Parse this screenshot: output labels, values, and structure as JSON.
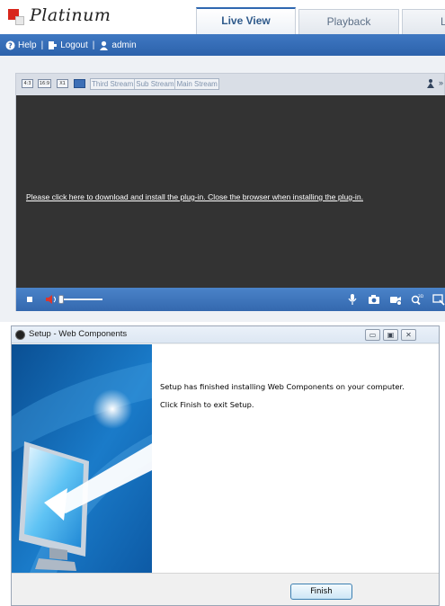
{
  "app": {
    "brand": "Platinum"
  },
  "tabs": [
    {
      "label": "Live View",
      "active": true
    },
    {
      "label": "Playback",
      "active": false
    },
    {
      "label": "L",
      "active": false
    }
  ],
  "nav": {
    "help": "Help",
    "logout": "Logout",
    "user": "admin",
    "separator": "|"
  },
  "toolbar": {
    "buttons": [
      "4:3",
      "16:9",
      "X1",
      "auto"
    ],
    "streams": [
      "Third Stream",
      "Sub Stream",
      "Main Stream"
    ],
    "more": "»"
  },
  "video": {
    "plugin_message": "Please click here to download and install the plug-in. Close the browser when installing the plug-in."
  },
  "controls": {
    "volume_level": 0.0,
    "icons": [
      "microphone-icon",
      "camera-icon",
      "record-icon",
      "zoom-3d-icon",
      "fullscreen-icon"
    ],
    "zoom_label": "3D"
  },
  "dialog": {
    "title": "Setup - Web Components",
    "window_buttons": [
      "▭",
      "▣",
      "✕"
    ],
    "message_1": "Setup has finished installing Web Components on your computer.",
    "message_2": "Click Finish to exit Setup.",
    "finish_label": "Finish"
  },
  "colors": {
    "accent": "#2c62ab",
    "video_bg": "#333333",
    "brand_red": "#d8261c"
  }
}
